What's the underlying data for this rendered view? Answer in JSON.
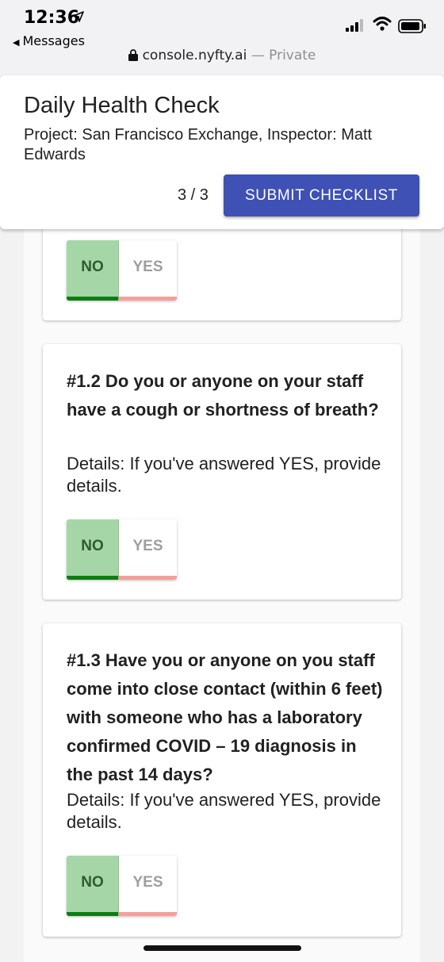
{
  "status_bar": {
    "time": "12:36",
    "back_label": "Messages",
    "url": "console.nyfty.ai",
    "url_separator": " — ",
    "private_label": "Private"
  },
  "header": {
    "title": "Daily Health Check",
    "subtitle": "Project: San Francisco Exchange, Inspector: Matt Edwards",
    "progress": "3 / 3",
    "submit_label": "SUBMIT CHECKLIST"
  },
  "questions": [
    {
      "no_label": "NO",
      "yes_label": "YES",
      "selected": "NO"
    },
    {
      "text": "#1.2 Do you or anyone on your staff have a cough or shortness of breath?",
      "details": "Details: If you've answered YES, provide details.",
      "no_label": "NO",
      "yes_label": "YES",
      "selected": "NO"
    },
    {
      "text": "#1.3 Have you or anyone on you staff come into close contact (within 6 feet) with someone who has a laboratory confirmed COVID – 19 diagnosis in the past 14 days?",
      "details": "Details: If you've answered YES, provide details.",
      "no_label": "NO",
      "yes_label": "YES",
      "selected": "NO"
    }
  ],
  "colors": {
    "primary": "#3f51b5",
    "no_selected_bg": "#a5d6a7",
    "no_underline": "#0e7d12",
    "yes_underline": "#f4a09a"
  }
}
